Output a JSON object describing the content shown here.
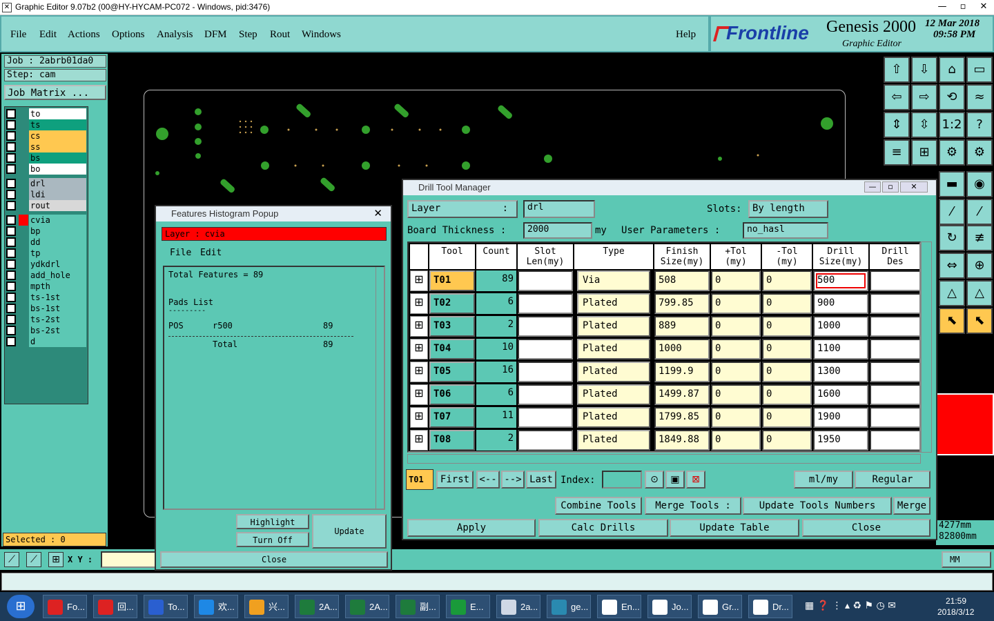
{
  "window_title": "Graphic Editor 9.07b2 (00@HY-HYCAM-PC072 - Windows, pid:3476)",
  "window_controls": [
    "—",
    "▫",
    "✕"
  ],
  "menu": [
    "File",
    "Edit",
    "Actions",
    "Options",
    "Analysis",
    "DFM",
    "Step",
    "Rout",
    "Windows"
  ],
  "help": "Help",
  "brand": {
    "logo": "Frontline",
    "product": "Genesis 2000",
    "subtitle": "Graphic Editor",
    "date": "12 Mar 2018",
    "time": "09:58 PM"
  },
  "job": "Job : 2abrb01da0",
  "step": "Step: cam",
  "job_matrix": "Job Matrix ...",
  "layers_group1": [
    {
      "name": "to",
      "color": "#ffffff"
    },
    {
      "name": "ts",
      "color": "#0fa07e"
    },
    {
      "name": "cs",
      "color": "#ffc850"
    },
    {
      "name": "ss",
      "color": "#ffc850"
    },
    {
      "name": "bs",
      "color": "#0fa07e"
    },
    {
      "name": "bo",
      "color": "#ffffff"
    }
  ],
  "layers_group2": [
    {
      "name": "drl",
      "color": "#aab8c0"
    },
    {
      "name": "ldi",
      "color": "#aab8c0"
    },
    {
      "name": "rout",
      "color": "#d8d8d8"
    }
  ],
  "layers_group3": [
    "cvia",
    "bp",
    "dd",
    "tp",
    "ydkdrl",
    "add_hole",
    "mpth",
    "ts-1st",
    "bs-1st",
    "ts-2st",
    "bs-2st",
    "d"
  ],
  "selected": "Selected : 0",
  "xy_label": "X Y :",
  "units": "MM",
  "coords": [
    "4277mm",
    "82800mm"
  ],
  "histogram": {
    "title": "Features Histogram Popup",
    "layer": "Layer : cvia",
    "menu": [
      "File",
      "Edit"
    ],
    "total": "Total Features = 89",
    "pads_list": "Pads List",
    "dashes": "---------",
    "row": {
      "pos": "POS",
      "sym": "r500",
      "count": "89"
    },
    "total_label": "Total",
    "total_count": "89",
    "highlight": "Highlight",
    "turn_off": "Turn Off",
    "update": "Update",
    "close": "Close"
  },
  "dtm": {
    "title": "Drill Tool Manager",
    "layer_label": "Layer",
    "layer": "drl",
    "slots_label": "Slots:",
    "slots": "By length",
    "thickness_label": "Board Thickness :",
    "thickness": "2000",
    "thickness_unit": "my",
    "user_params_label": "User Parameters :",
    "user_params": "no_hasl",
    "headers": [
      "Tool",
      "Count",
      "Slot\nLen(my)",
      "Type",
      "Finish\nSize(my)",
      "+Tol\n(my)",
      "-Tol\n(my)",
      "Drill\nSize(my)",
      "Drill\nDes"
    ],
    "rows": [
      {
        "tool": "T01",
        "count": "89",
        "type": "Via",
        "finish": "508",
        "ptol": "0",
        "mtol": "0",
        "drill": "500"
      },
      {
        "tool": "T02",
        "count": "6",
        "type": "Plated",
        "finish": "799.85",
        "ptol": "0",
        "mtol": "0",
        "drill": "900"
      },
      {
        "tool": "T03",
        "count": "2",
        "type": "Plated",
        "finish": "889",
        "ptol": "0",
        "mtol": "0",
        "drill": "1000"
      },
      {
        "tool": "T04",
        "count": "10",
        "type": "Plated",
        "finish": "1000",
        "ptol": "0",
        "mtol": "0",
        "drill": "1100"
      },
      {
        "tool": "T05",
        "count": "16",
        "type": "Plated",
        "finish": "1199.9",
        "ptol": "0",
        "mtol": "0",
        "drill": "1300"
      },
      {
        "tool": "T06",
        "count": "6",
        "type": "Plated",
        "finish": "1499.87",
        "ptol": "0",
        "mtol": "0",
        "drill": "1600"
      },
      {
        "tool": "T07",
        "count": "11",
        "type": "Plated",
        "finish": "1799.85",
        "ptol": "0",
        "mtol": "0",
        "drill": "1900"
      },
      {
        "tool": "T08",
        "count": "2",
        "type": "Plated",
        "finish": "1849.88",
        "ptol": "0",
        "mtol": "0",
        "drill": "1950"
      }
    ],
    "current": "T01",
    "first": "First",
    "prev": "<--",
    "next": "-->",
    "last": "Last",
    "index_label": "Index:",
    "units": "ml/my",
    "mode": "Regular",
    "combine": "Combine Tools",
    "merge_label": "Merge Tools :",
    "update_numbers": "Update Tools Numbers",
    "merge": "Merge",
    "apply": "Apply",
    "calc": "Calc Drills",
    "update_table": "Update Table",
    "close": "Close"
  },
  "taskbar": [
    {
      "label": "Fo...",
      "color": "#d22"
    },
    {
      "label": "回...",
      "color": "#d22"
    },
    {
      "label": "To...",
      "color": "#2a5fd0"
    },
    {
      "label": "欢...",
      "color": "#1e88e5"
    },
    {
      "label": "兴...",
      "color": "#f0a020"
    },
    {
      "label": "2A...",
      "color": "#1e7b3c"
    },
    {
      "label": "2A...",
      "color": "#1e7b3c"
    },
    {
      "label": "副...",
      "color": "#1e7b3c"
    },
    {
      "label": "E...",
      "color": "#1a9a3a"
    },
    {
      "label": "2a...",
      "color": "#cfd8e6"
    },
    {
      "label": "ge...",
      "color": "#2a8ab0"
    },
    {
      "label": "En...",
      "color": "#ffffff"
    },
    {
      "label": "Jo...",
      "color": "#ffffff"
    },
    {
      "label": "Gr...",
      "color": "#ffffff"
    },
    {
      "label": "Dr...",
      "color": "#ffffff"
    }
  ],
  "clock": {
    "time": "21:59",
    "date": "2018/3/12"
  }
}
